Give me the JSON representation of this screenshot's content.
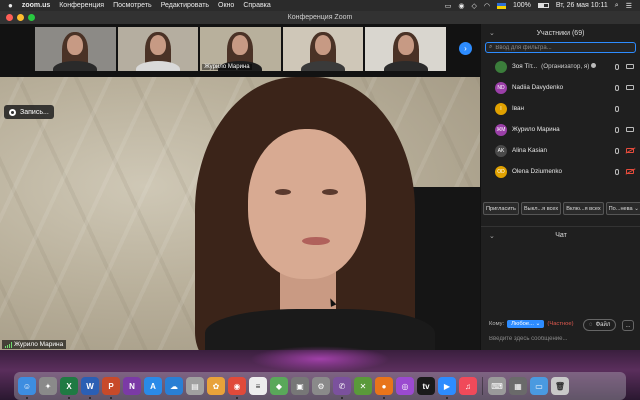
{
  "menubar": {
    "app_name": "zoom.us",
    "menus": [
      "Конференция",
      "Посмотреть",
      "Редактировать",
      "Окно",
      "Справка"
    ],
    "battery": "100%",
    "datetime": "Вт, 26 мая  10:11"
  },
  "window": {
    "title": "Конференция Zoom"
  },
  "thumbnails": [
    {
      "name": "",
      "bg": "#8c8a86",
      "shirt": "#2a2a2a"
    },
    {
      "name": "",
      "bg": "#b5aea0",
      "shirt": "#d9d9d9"
    },
    {
      "name": "Журило Марина",
      "bg": "#b8b09c",
      "shirt": "#1d1d1d"
    },
    {
      "name": "",
      "bg": "#cfc7b8",
      "shirt": "#3a3a3a"
    },
    {
      "name": "",
      "bg": "#d9d6cf",
      "shirt": "#2b2b2b"
    }
  ],
  "main_video": {
    "record_label": "Запись...",
    "speaker_name": "Журило Марина"
  },
  "participants": {
    "title": "Участники (69)",
    "search_placeholder": "Ввод для фильтра...",
    "rows": [
      {
        "initials": "",
        "name": "Зоя Тіт...",
        "role": "(Организатор, я)",
        "avatar_color": "#3b7d3b",
        "mic": "on",
        "cam": "on"
      },
      {
        "initials": "ND",
        "name": "Nadiia Davydenko",
        "role": "",
        "avatar_color": "#9b3fa8",
        "mic": "on",
        "cam": "on"
      },
      {
        "initials": "I",
        "name": "Іван",
        "role": "",
        "avatar_color": "#e0a100",
        "mic": "on",
        "cam": "none"
      },
      {
        "initials": "ЖМ",
        "name": "Журило Марина",
        "role": "",
        "avatar_color": "#9b3fa8",
        "mic": "on",
        "cam": "on"
      },
      {
        "initials": "AK",
        "name": "Alina Kasian",
        "role": "",
        "avatar_color": "#4a4a4a",
        "mic": "on",
        "cam": "off"
      },
      {
        "initials": "OD",
        "name": "Olena Dziumenko",
        "role": "",
        "avatar_color": "#e0a100",
        "mic": "on",
        "cam": "off"
      }
    ],
    "buttons": {
      "invite": "Пригласить",
      "mute_all": "Выкл...я всех",
      "unmute_all": "Вклю...я всех",
      "more": "По...нева"
    }
  },
  "chat": {
    "title": "Чат",
    "to_label": "Кому:",
    "to_value": "Любое...",
    "private_label": "(Частное)",
    "file_label": "Файл",
    "more_label": "...",
    "input_placeholder": "Введите здесь сообщение..."
  },
  "dock": {
    "apps": [
      {
        "icon": "finder-icon",
        "glyph": "☺",
        "bg": "#3d8de0",
        "run": true
      },
      {
        "icon": "launchpad-icon",
        "glyph": "✦",
        "bg": "#8a8a8a",
        "run": false
      },
      {
        "icon": "excel-icon",
        "glyph": "X",
        "bg": "#1f7a43",
        "run": true
      },
      {
        "icon": "word-icon",
        "glyph": "W",
        "bg": "#2b5fb4",
        "run": true
      },
      {
        "icon": "powerpoint-icon",
        "glyph": "P",
        "bg": "#c84a2a",
        "run": true
      },
      {
        "icon": "onenote-icon",
        "glyph": "N",
        "bg": "#7b3aa6",
        "run": false
      },
      {
        "icon": "appstore-icon",
        "glyph": "A",
        "bg": "#2a8ae8",
        "run": false
      },
      {
        "icon": "onedrive-icon",
        "glyph": "☁",
        "bg": "#2a7fd4",
        "run": false
      },
      {
        "icon": "preview-icon",
        "glyph": "▤",
        "bg": "#a0a0a0",
        "run": false
      },
      {
        "icon": "photos-icon",
        "glyph": "✿",
        "bg": "#e8a23a",
        "run": false
      },
      {
        "icon": "chrome-icon",
        "glyph": "◉",
        "bg": "#e04a3a",
        "run": true
      },
      {
        "icon": "notes-icon",
        "glyph": "≡",
        "bg": "#eeeeee",
        "run": false
      },
      {
        "icon": "maps-icon",
        "glyph": "◆",
        "bg": "#5aa85a",
        "run": false
      },
      {
        "icon": "image-capture-icon",
        "glyph": "▣",
        "bg": "#777777",
        "run": false
      },
      {
        "icon": "system-preferences-icon",
        "glyph": "⚙",
        "bg": "#8a8a8a",
        "run": false
      },
      {
        "icon": "viber-icon",
        "glyph": "✆",
        "bg": "#7b519d",
        "run": true
      },
      {
        "icon": "xcode-icon",
        "glyph": "✕",
        "bg": "#5a9a3a",
        "run": false
      },
      {
        "icon": "firefox-icon",
        "glyph": "●",
        "bg": "#e8741a",
        "run": true
      },
      {
        "icon": "podcasts-icon",
        "glyph": "◎",
        "bg": "#9b4ad0",
        "run": false
      },
      {
        "icon": "tv-icon",
        "glyph": "tv",
        "bg": "#1a1a1a",
        "run": false
      },
      {
        "icon": "zoom-icon",
        "glyph": "▶",
        "bg": "#2d8cff",
        "run": true
      },
      {
        "icon": "music-icon",
        "glyph": "♫",
        "bg": "#f04a5a",
        "run": false
      }
    ],
    "right_apps": [
      {
        "icon": "keyboard-viewer-icon",
        "glyph": "⌨",
        "bg": "#9a9a9a",
        "run": false
      },
      {
        "icon": "screenshot-icon",
        "glyph": "▦",
        "bg": "#6a6a6a",
        "run": false
      },
      {
        "icon": "folder-icon",
        "glyph": "▭",
        "bg": "#4a9ae0",
        "run": false
      },
      {
        "icon": "trash-icon",
        "glyph": "🗑",
        "bg": "#c9c9c9",
        "run": false
      }
    ]
  }
}
